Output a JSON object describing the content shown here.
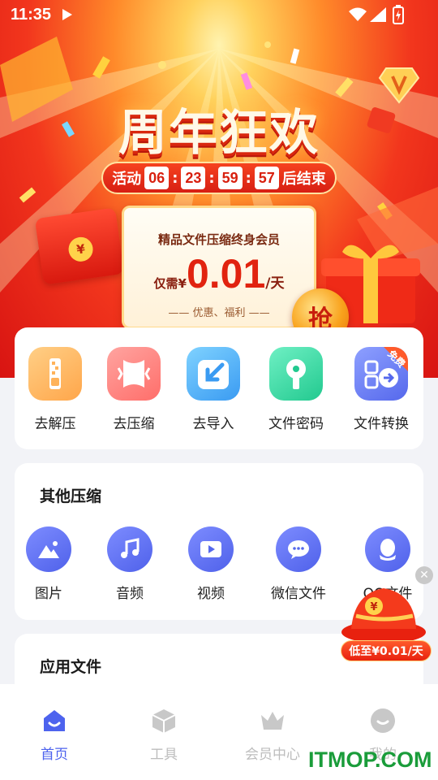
{
  "status_bar": {
    "time": "11:35"
  },
  "banner": {
    "title": "周年狂欢",
    "countdown": {
      "prefix": "活动",
      "hours": "06",
      "minutes": "23",
      "seconds": "59",
      "centis": "57",
      "suffix": "后结束"
    },
    "offer_title": "精品文件压缩终身会员",
    "price_prefix": "仅需¥",
    "price": "0.01",
    "price_unit": "/天",
    "offer_sub": "—— 优惠、福利 ——",
    "grab_label": "抢"
  },
  "main_tools": [
    {
      "label": "去解压",
      "icon": "unzip-icon"
    },
    {
      "label": "去压缩",
      "icon": "compress-icon"
    },
    {
      "label": "去导入",
      "icon": "import-icon"
    },
    {
      "label": "文件密码",
      "icon": "lock-key-icon"
    },
    {
      "label": "文件转换",
      "icon": "convert-icon",
      "badge": "免费"
    }
  ],
  "other_section": {
    "title": "其他压缩",
    "items": [
      {
        "label": "图片",
        "icon": "image-icon"
      },
      {
        "label": "音频",
        "icon": "music-icon"
      },
      {
        "label": "视频",
        "icon": "video-icon"
      },
      {
        "label": "微信文件",
        "icon": "wechat-icon"
      },
      {
        "label": "QQ文件",
        "icon": "qq-icon"
      }
    ]
  },
  "app_section": {
    "title": "应用文件"
  },
  "promo": {
    "tag": "低至¥0.01/天",
    "close": "✕"
  },
  "bottom_nav": [
    {
      "label": "首页",
      "icon": "home-icon",
      "active": true
    },
    {
      "label": "工具",
      "icon": "box-icon",
      "active": false
    },
    {
      "label": "会员中心",
      "icon": "crown-icon",
      "active": false
    },
    {
      "label": "我的",
      "icon": "profile-icon",
      "active": false
    }
  ],
  "watermark": "ITMOP.COM",
  "colors": {
    "accent": "#4d63ee",
    "banner_red": "#e8210f",
    "nav_inactive": "#bdbdbd"
  }
}
